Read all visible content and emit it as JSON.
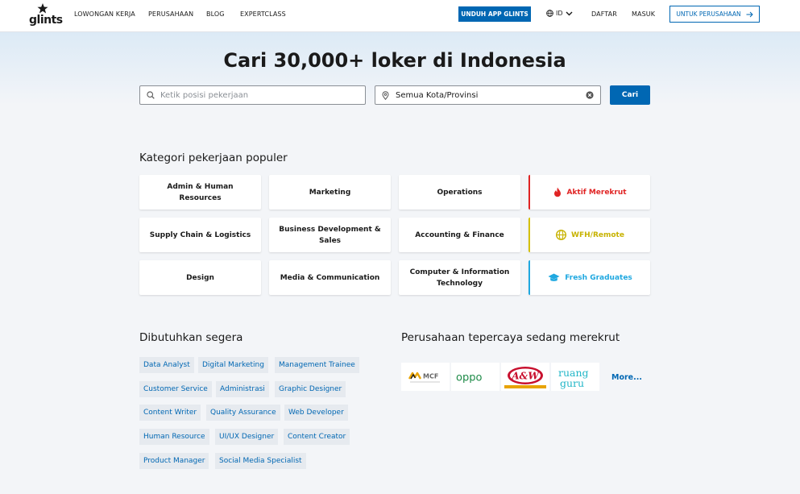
{
  "header": {
    "logo_text": "glints",
    "nav": [
      "LOWONGAN KERJA",
      "PERUSAHAAN",
      "BLOG",
      "EXPERTCLASS"
    ],
    "download_app": "UNDUH APP GLINTS",
    "language": "ID",
    "register": "DAFTAR",
    "login": "MASUK",
    "for_company": "UNTUK PERUSAHAAN"
  },
  "hero": {
    "title": "Cari 30,000+ loker di Indonesia",
    "job_placeholder": "Ketik posisi pekerjaan",
    "location_value": "Semua Kota/Provinsi",
    "search_button": "Cari"
  },
  "categories": {
    "title": "Kategori pekerjaan populer",
    "items": [
      "Admin & Human Resources",
      "Marketing",
      "Operations",
      "Aktif Merekrut",
      "Supply Chain & Logistics",
      "Business Development & Sales",
      "Accounting & Finance",
      "WFH/Remote",
      "Design",
      "Media & Communication",
      "Computer & Information Technology",
      "Fresh Graduates"
    ]
  },
  "urgent": {
    "title": "Dibutuhkan segera",
    "tags": [
      "Data Analyst",
      "Digital Marketing",
      "Management Trainee",
      "Customer Service",
      "Administrasi",
      "Graphic Designer",
      "Content Writer",
      "Quality Assurance",
      "Web Developer",
      "Human Resource",
      "UI/UX Designer",
      "Content Creator",
      "Product Manager",
      "Social Media Specialist"
    ]
  },
  "companies": {
    "title": "Perusahaan tepercaya sedang merekrut",
    "logos": [
      "MCF",
      "oppo",
      "A&W",
      "ruang guru"
    ],
    "more": "More..."
  },
  "colors": {
    "primary": "#0067b3",
    "red": "#e02424",
    "yellow": "#c7b200",
    "cyan": "#1fa8e0"
  }
}
